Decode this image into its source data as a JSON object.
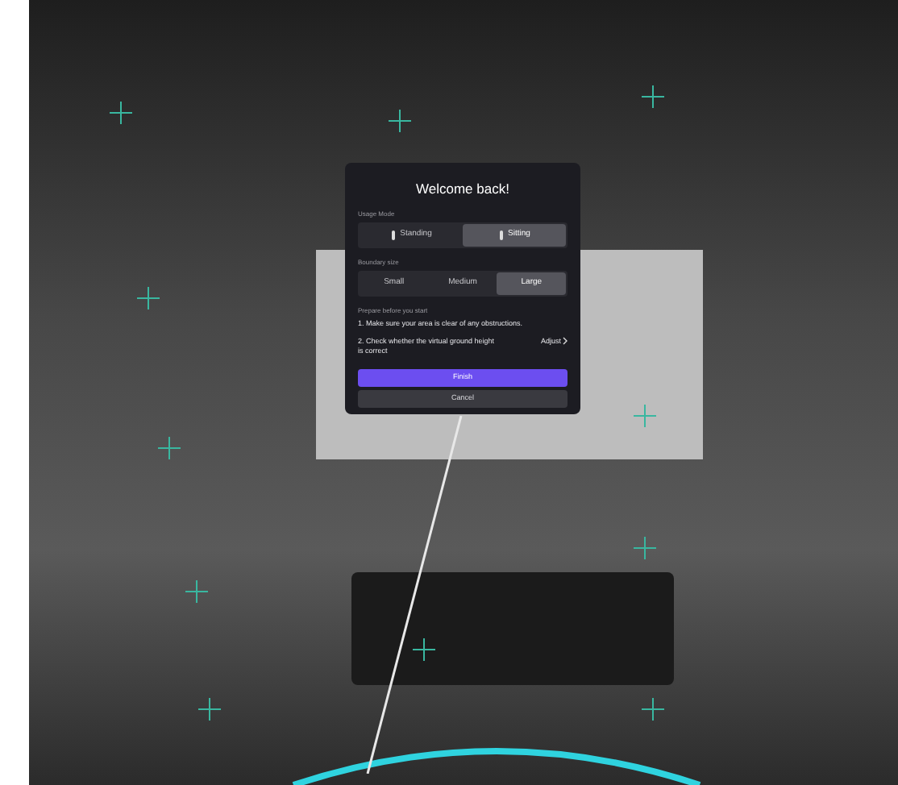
{
  "dialog": {
    "title": "Welcome back!",
    "usage_mode": {
      "label": "Usage Mode",
      "options": [
        {
          "label": "Standing",
          "selected": false
        },
        {
          "label": "Sitting",
          "selected": true
        }
      ]
    },
    "boundary_size": {
      "label": "Boundary size",
      "options": [
        {
          "label": "Small",
          "selected": false
        },
        {
          "label": "Medium",
          "selected": false
        },
        {
          "label": "Large",
          "selected": true
        }
      ]
    },
    "prepare": {
      "label": "Prepare before you start",
      "steps": [
        "1. Make sure your area is clear of any obstructions.",
        "2. Check whether the virtual ground height is correct"
      ],
      "adjust_link": "Adjust"
    },
    "buttons": [
      {
        "label": "Finish",
        "kind": "primary"
      },
      {
        "label": "Cancel",
        "kind": "secondary"
      }
    ]
  }
}
